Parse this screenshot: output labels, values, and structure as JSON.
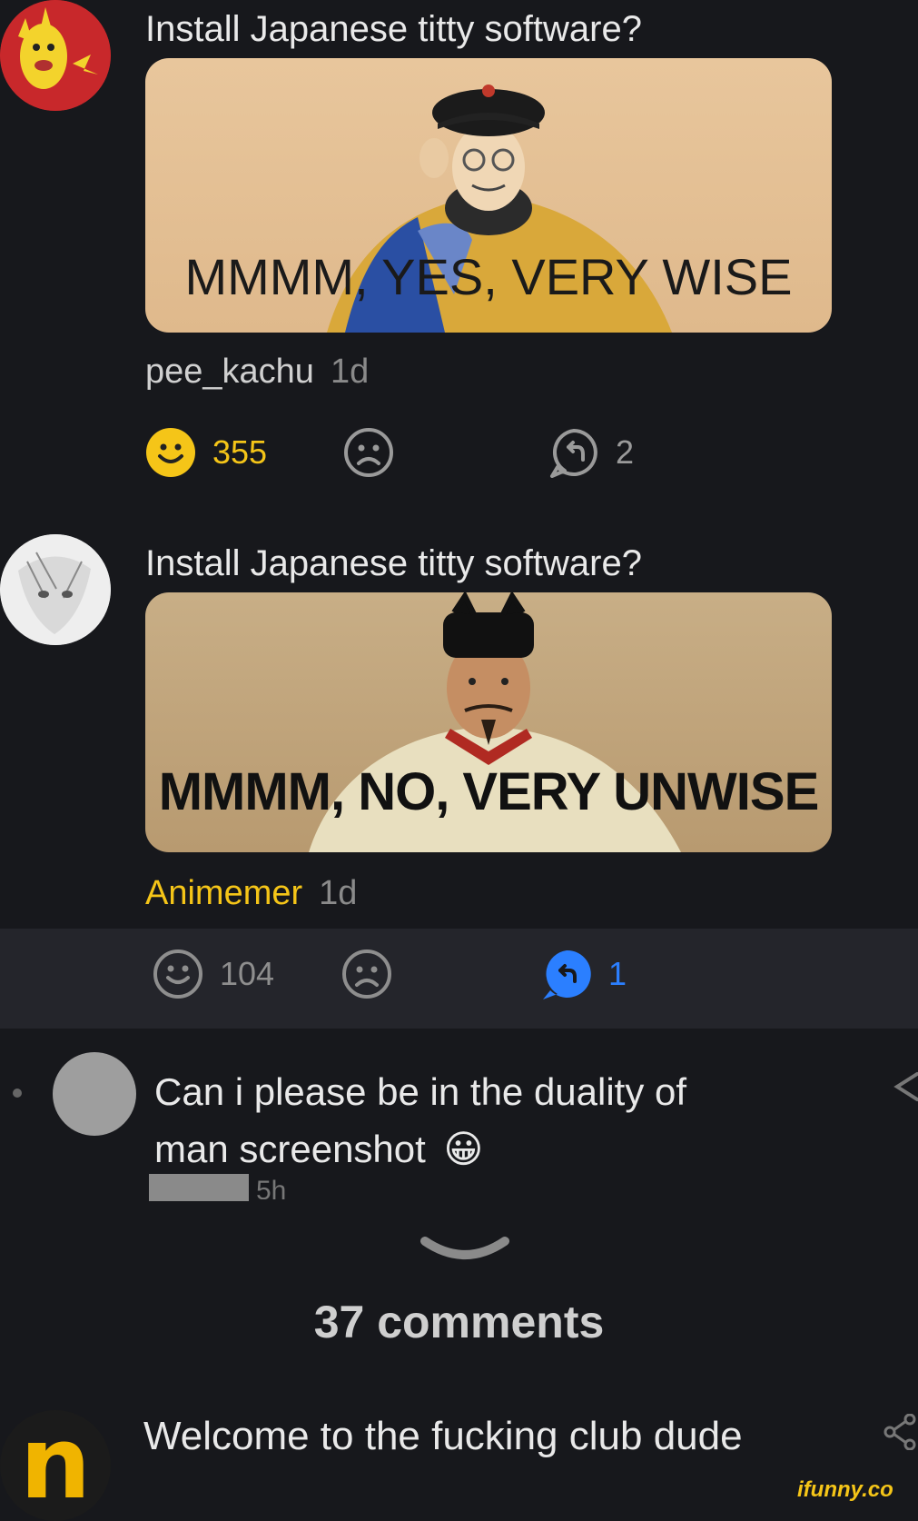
{
  "comments": [
    {
      "text": "Install Japanese titty software?",
      "image_caption": "MMMM, YES, VERY WISE",
      "username": "pee_kachu",
      "time": "1d",
      "likes": "355",
      "replies": "2"
    },
    {
      "text": "Install Japanese titty software?",
      "image_caption": "MMMM, NO, VERY UNWISE",
      "username": "Animemer",
      "time": "1d",
      "likes": "104",
      "replies": "1"
    }
  ],
  "reply": {
    "text_line1": "Can i please be in the duality of",
    "text_line2": "man screenshot",
    "emoji": "😀",
    "time": "5h"
  },
  "comments_count_label": "37 comments",
  "bottom_comment": {
    "text": "Welcome to the fucking club dude",
    "avatar_letter": "n"
  },
  "watermark": "ifunny.co",
  "colors": {
    "background": "#17181c",
    "highlight_bar": "#24252b",
    "accent_yellow": "#f5c518",
    "reply_blue": "#2b7fff"
  }
}
